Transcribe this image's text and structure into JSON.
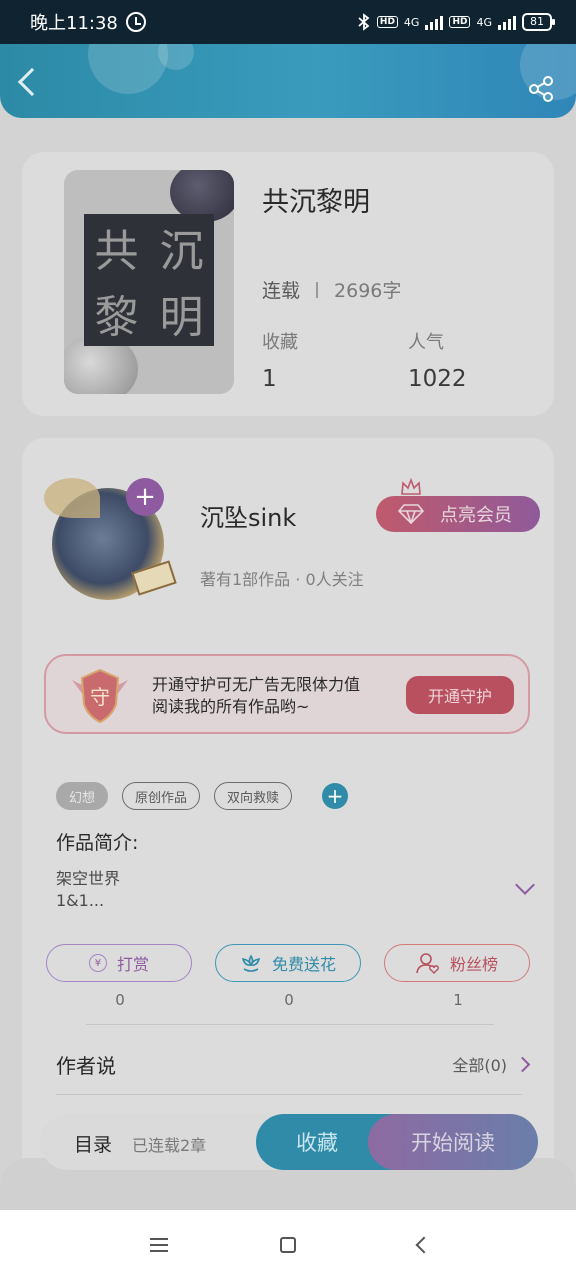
{
  "status_bar": {
    "time": "晚上11:38",
    "net1": "4G",
    "hd1": "HD",
    "net2": "4G",
    "hd2": "HD",
    "battery": "81"
  },
  "book": {
    "title": "共沉黎明",
    "cover_chars": [
      "共",
      "沉",
      "黎",
      "明"
    ],
    "status": "连载",
    "word_count": "2696字",
    "favorites_label": "收藏",
    "favorites_value": "1",
    "popularity_label": "人气",
    "popularity_value": "1022"
  },
  "author": {
    "name": "沉坠sink",
    "works": "著有1部作品 · 0人关注",
    "vip_label": "点亮会员",
    "follow_symbol": "+"
  },
  "guard": {
    "badge_char": "守",
    "line1": "开通守护可无广告无限体力值",
    "line2": "阅读我的所有作品哟~",
    "button": "开通守护"
  },
  "tags": [
    "幻想",
    "原创作品",
    "双向救赎"
  ],
  "tag_add_symbol": "+",
  "intro": {
    "title": "作品简介:",
    "line1": "架空世界",
    "line2": "1&1..."
  },
  "actions": [
    {
      "label": "打赏",
      "count": "0",
      "icon": "coin-icon"
    },
    {
      "label": "免费送花",
      "count": "0",
      "icon": "flower-icon"
    },
    {
      "label": "粉丝榜",
      "count": "1",
      "icon": "fans-icon"
    }
  ],
  "author_say": {
    "title": "作者说",
    "all": "全部(0)"
  },
  "bottom_bar": {
    "toc": "目录",
    "toc_status": "已连载2章",
    "collect": "收藏",
    "read": "开始阅读"
  },
  "colors": {
    "accent_blue": "#2f8ba8",
    "accent_purple": "#8e5ba1",
    "accent_red": "#b8505f"
  }
}
